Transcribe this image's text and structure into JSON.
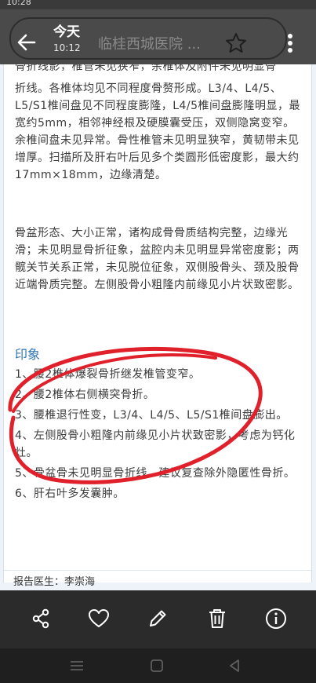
{
  "status_bar": {
    "time": "10:28"
  },
  "header": {
    "title": "今天",
    "subtitle": "10:12",
    "background_title": "临桂西城医院 ..."
  },
  "report": {
    "top_cut_text": "骨折线影，椎管未见狭窄，余椎体及附件未见明显骨",
    "findings": [
      "折线。各椎体均见不同程度骨赘形成。L3/4、L4/5、L5/S1椎间盘见不同程度膨隆，L4/5椎间盘膨隆明显，最宽约5mm，相邻神经根及硬膜囊受压，双侧隐窝变窄。余椎间盘未见异常。骨性椎管未见明显狭窄，黄韧带未见增厚。扫描所及肝右叶后见多个类圆形低密度影，最大约17mm×18mm，边缘清楚。",
      "骨盆形态、大小正常，诸构成骨骨质结构完整，边缘光滑；未见明显骨折征象，盆腔内未见明显异常密度影；两髋关节关系正常，未见脱位征象，双侧股骨头、颈及股骨近端骨质完整。左侧股骨小粗隆内前缘见小片状致密影。"
    ],
    "impression_heading": "印象",
    "impressions": [
      "1、腰2椎体爆裂骨折继发椎管变窄。",
      "2、腰2椎体右侧横突骨折。",
      "3、腰椎退行性变，L3/4、L4/5、L5/S1椎间盘膨出。",
      "4、左侧股骨小粗隆内前缘见小片状致密影，考虑为钙化灶。",
      "5、骨盆骨未见明显骨折线，建议复查除外隐匿性骨折。",
      "6、肝右叶多发囊肿。"
    ],
    "doctor_label": "报告医生：李崇海"
  },
  "annotation_color": "#e0202a",
  "icons": {
    "back": "arrow-left-icon",
    "favorite_top": "star-icon",
    "more": "more-vertical-icon",
    "share": "share-icon",
    "like": "heart-icon",
    "edit": "pencil-icon",
    "delete": "trash-icon",
    "info": "info-icon"
  }
}
